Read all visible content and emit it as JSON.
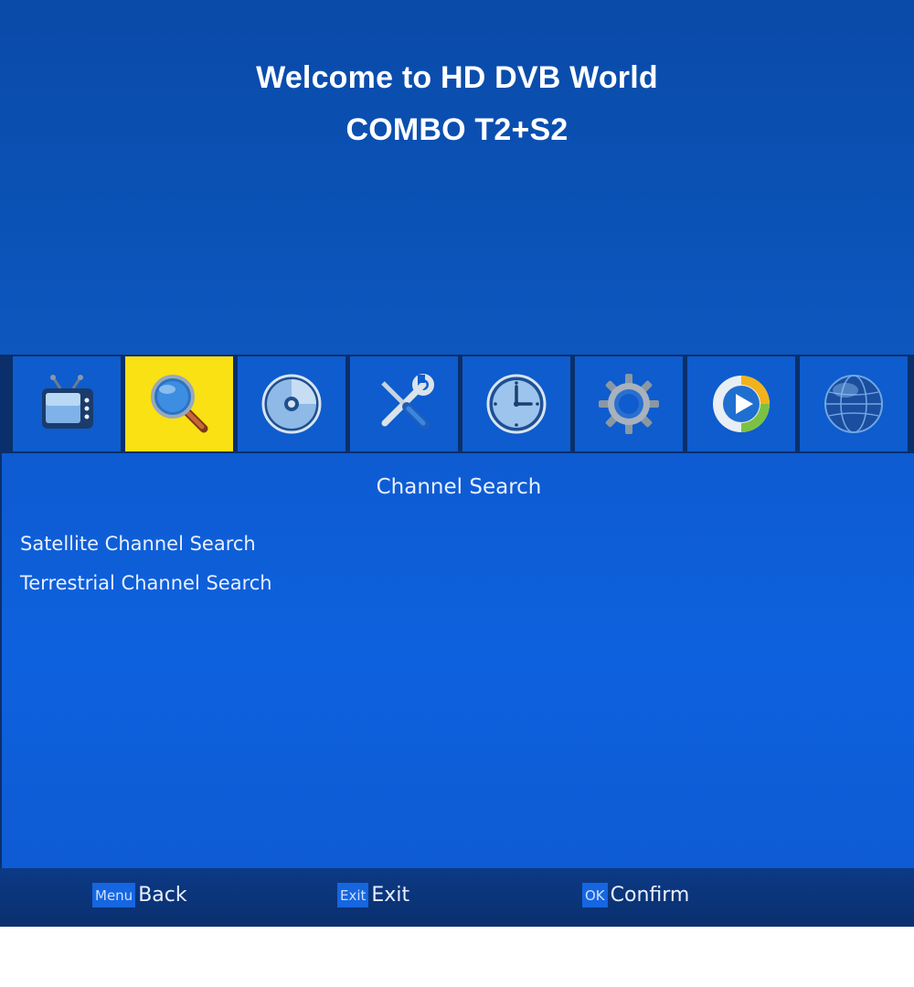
{
  "banner": {
    "line1": "Welcome to HD DVB World",
    "line2": "COMBO T2+S2"
  },
  "tabs": [
    {
      "icon": "tv-icon",
      "active": false
    },
    {
      "icon": "search-magnifier-icon",
      "active": true
    },
    {
      "icon": "disc-icon",
      "active": false
    },
    {
      "icon": "tools-icon",
      "active": false
    },
    {
      "icon": "clock-icon",
      "active": false
    },
    {
      "icon": "gear-icon",
      "active": false
    },
    {
      "icon": "media-play-icon",
      "active": false
    },
    {
      "icon": "globe-icon",
      "active": false
    }
  ],
  "panel": {
    "title": "Channel Search",
    "items": [
      "Satellite Channel Search",
      "Terrestrial Channel Search"
    ]
  },
  "footer": {
    "back": {
      "key": "Menu",
      "label": "Back"
    },
    "exit": {
      "key": "Exit",
      "label": "Exit"
    },
    "confirm": {
      "key": "OK",
      "label": "Confirm"
    }
  },
  "colors": {
    "banner": "#0b52b6",
    "tab": "#0e5ccd",
    "tab_active": "#f9e113",
    "panel": "#0e61de",
    "footer": "#0a2f6e"
  }
}
